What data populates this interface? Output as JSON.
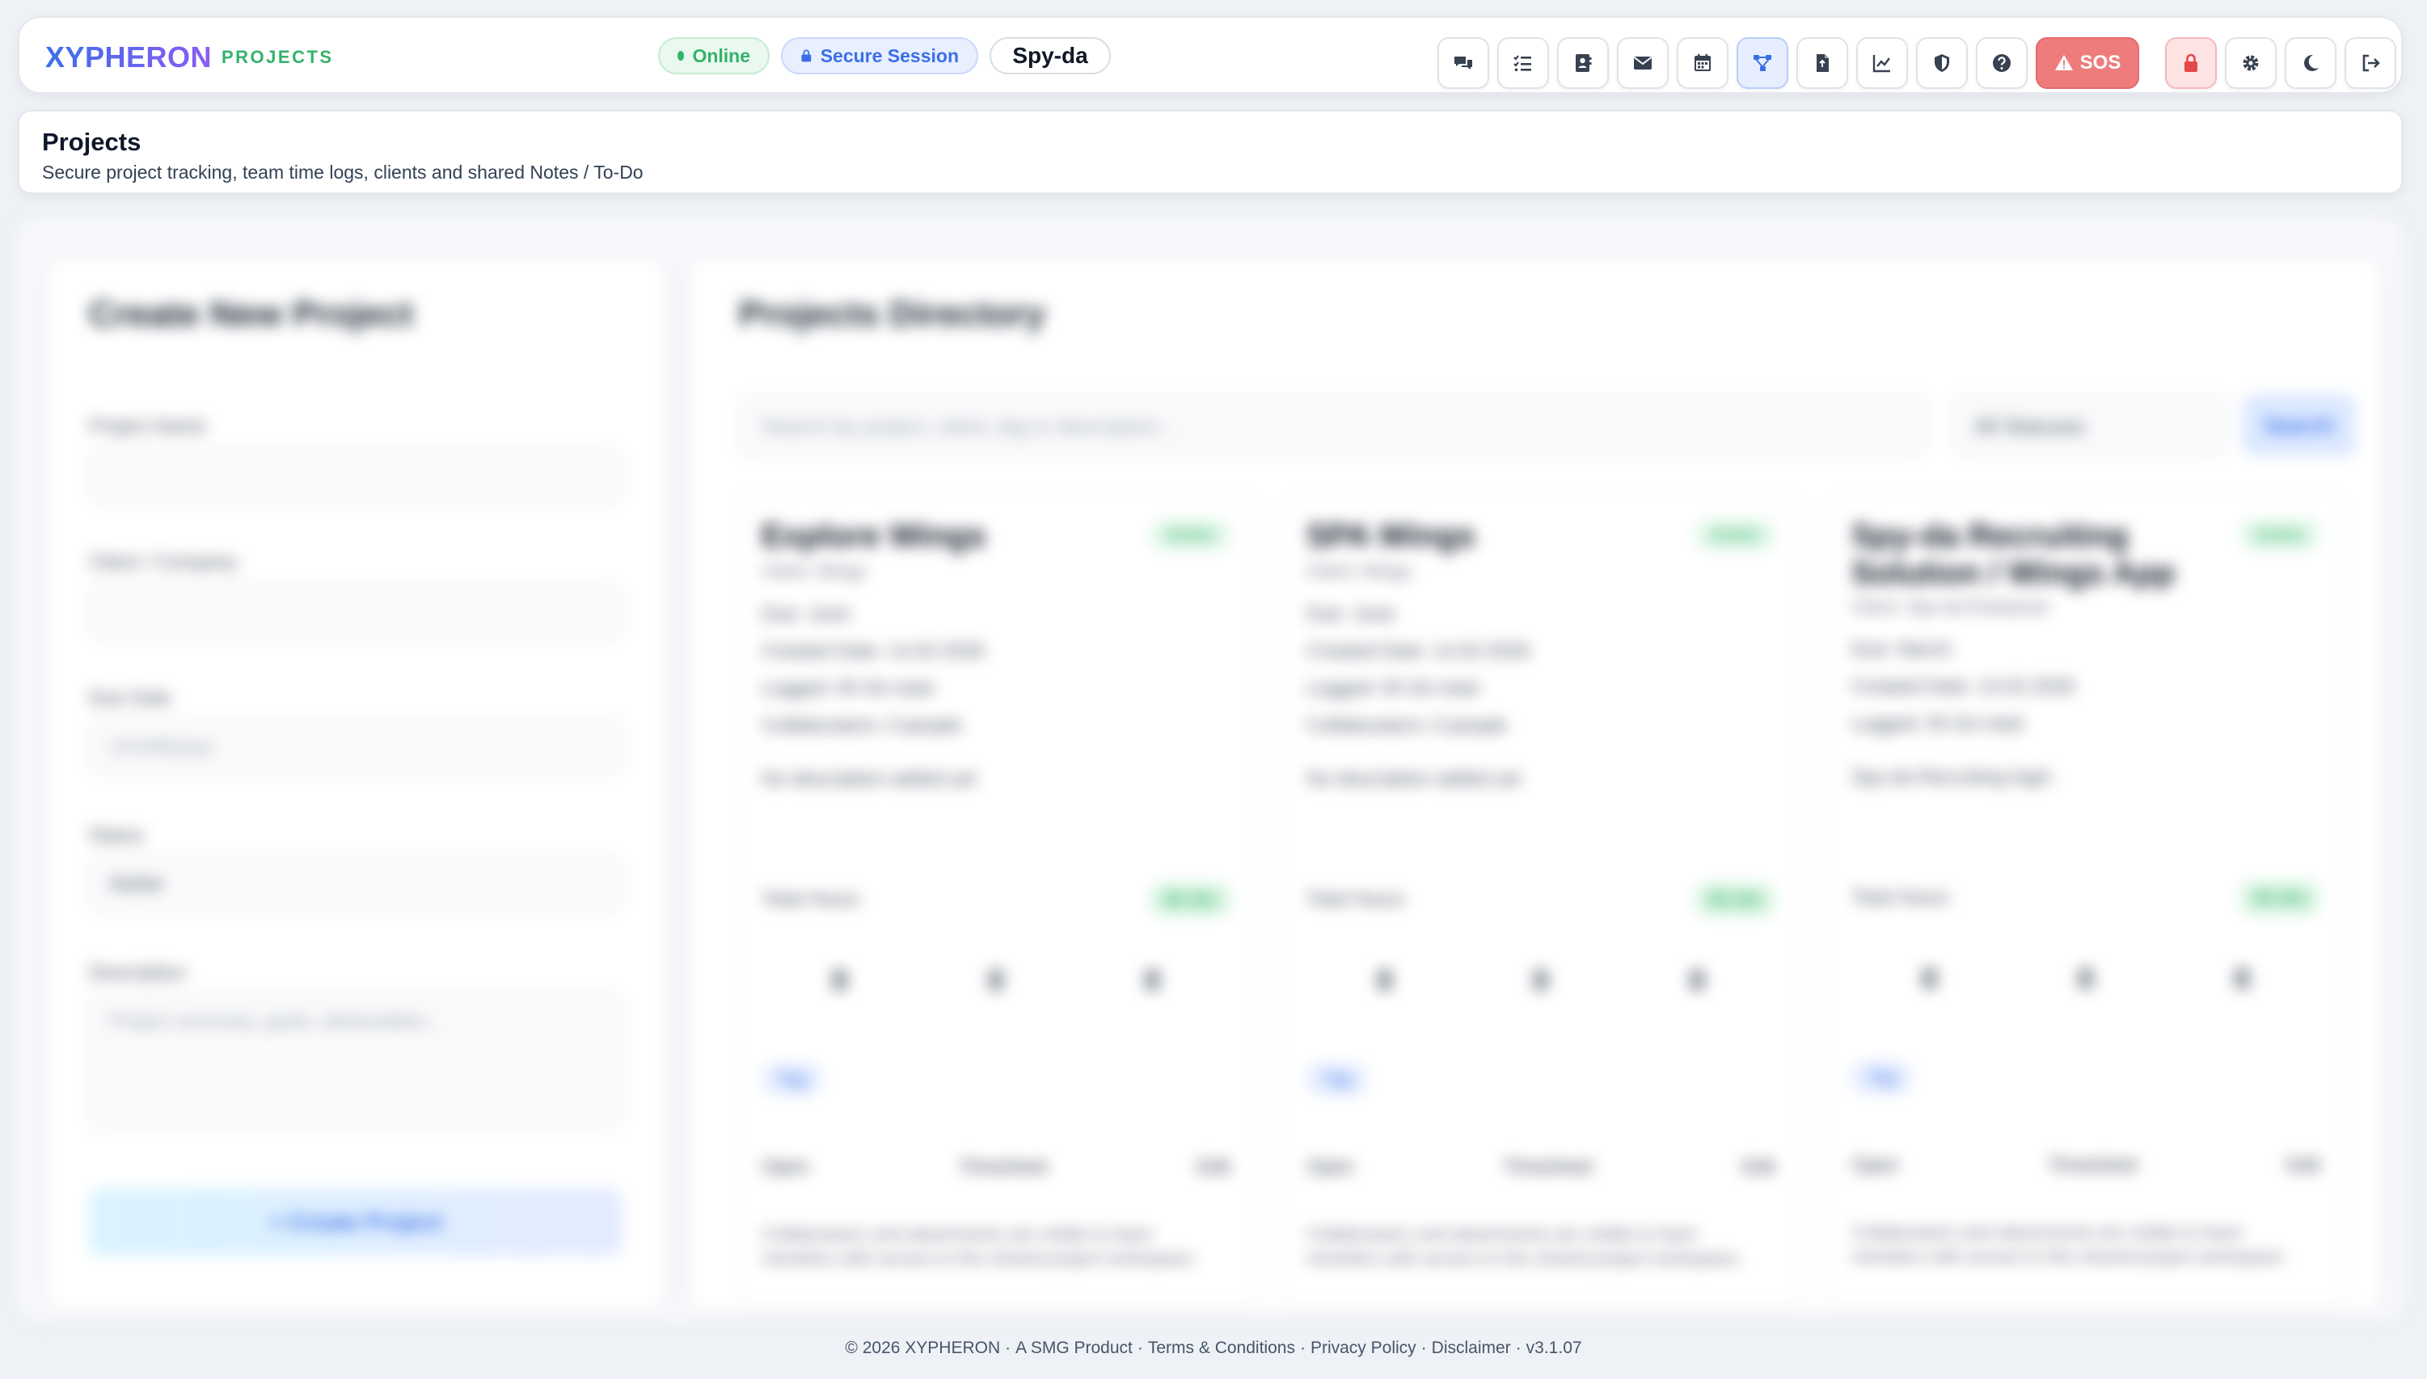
{
  "header": {
    "brand": "XYPHERON",
    "section": "PROJECTS",
    "status_online": "Online",
    "status_secure": "Secure Session",
    "user": "Spy-da",
    "sos_label": "SOS",
    "icons": [
      "chat-icon",
      "checklist-icon",
      "contacts-icon",
      "mail-icon",
      "calendar-icon",
      "projects-icon",
      "document-icon",
      "chart-icon",
      "shield-icon",
      "help-icon",
      "sos-icon",
      "lock-icon",
      "gear-icon",
      "moon-icon",
      "logout-icon"
    ],
    "colors": {
      "brand_start": "#3b6fe8",
      "brand_end": "#8b5cf6",
      "online": "#34b26a",
      "secure": "#3b6fe8",
      "sos": "#ee7c7c"
    }
  },
  "title_card": {
    "title": "Projects",
    "subtitle": "Secure project tracking, team time logs, clients and shared Notes / To-Do"
  },
  "create_panel": {
    "heading": "Create New Project",
    "project_name_label": "Project Name",
    "client_label": "Client / Company",
    "due_date_label": "Due Date",
    "due_date_placeholder": "mm/dd/yyyy",
    "status_label": "Status",
    "status_value": "Active",
    "description_label": "Description",
    "description_placeholder": "Project summary, goals, deliverables...",
    "create_button": "+ Create Project"
  },
  "directory": {
    "heading": "Projects Directory",
    "search_placeholder": "Search by project, client, tag or description...",
    "status_filter": "All Statuses",
    "search_button": "Search",
    "cards": [
      {
        "name": "Explore Wings",
        "client": "Client: Wings",
        "status": "Active",
        "meta": [
          "Due: June",
          "Created Date: 14.02.2026",
          "Logged: 0h 0m total",
          "Collaborators: 0 people"
        ],
        "description": "No description added yet",
        "hours_label": "Total Hours",
        "hours_value": "0h 0m",
        "stats": [
          "0",
          "0",
          "0"
        ],
        "tag": "Tag",
        "actions": [
          "Open",
          "Timesheet",
          "Edit"
        ],
        "note": "Collaborators and attachments are visible to team members with access to this shared project workspace."
      },
      {
        "name": "SPA Wings",
        "client": "Client: Wings",
        "status": "Active",
        "meta": [
          "Due: June",
          "Created Date: 14.02.2026",
          "Logged: 0h 0m total",
          "Collaborators: 0 people"
        ],
        "description": "No description added yet",
        "hours_label": "Total Hours",
        "hours_value": "0h 0m",
        "stats": [
          "0",
          "0",
          "0"
        ],
        "tag": "Tag",
        "actions": [
          "Open",
          "Timesheet",
          "Edit"
        ],
        "note": "Collaborators and attachments are visible to team members with access to this shared project workspace."
      },
      {
        "name": "Spy-da Recruiting Solution / Wings App",
        "client": "Client: Spy-da Enterprise",
        "status": "Active",
        "meta": [
          "Due: March",
          "Created Date: 14.02.2026",
          "Logged: 0h 0m total"
        ],
        "description": "Spy-da Recruiting login",
        "hours_label": "Total Hours",
        "hours_value": "0h 0m",
        "stats": [
          "0",
          "0",
          "0"
        ],
        "tag": "Tag",
        "actions": [
          "Open",
          "Timesheet",
          "Edit"
        ],
        "note": "Collaborators and attachments are visible to team members with access to this shared project workspace."
      }
    ]
  },
  "footer": {
    "copyright": "© 2026 XYPHERON",
    "product": "A SMG Product",
    "terms": "Terms & Conditions",
    "privacy": "Privacy Policy",
    "disclaimer": "Disclaimer",
    "version": "v3.1.07"
  }
}
